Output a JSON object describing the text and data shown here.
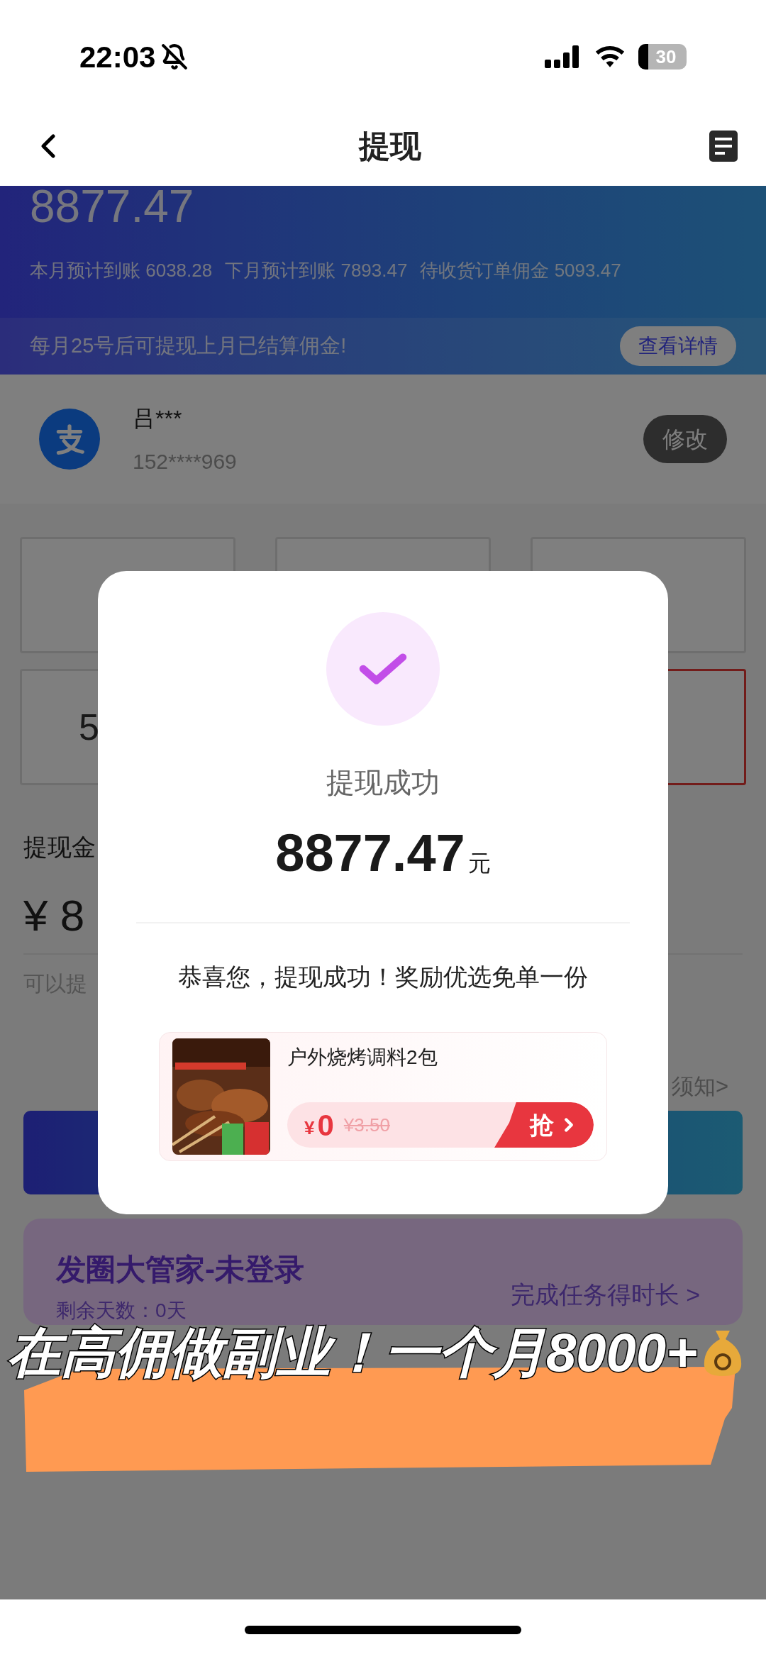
{
  "status_bar": {
    "time": "22:03",
    "battery": "30"
  },
  "nav": {
    "title": "提现"
  },
  "header": {
    "balance": "8877.47",
    "stats": [
      "本月预计到账 6038.28",
      "下月预计到账 7893.47",
      "待收货订单佣金 5093.47"
    ],
    "notice": "每月25号后可提现上月已结算佣金!",
    "details_button": "查看详情"
  },
  "account": {
    "name": "吕***",
    "phone": "152****969",
    "edit_button": "修改"
  },
  "tiles": [
    {
      "selected": false
    },
    {
      "selected": false
    },
    {
      "selected": false
    },
    {
      "label": "5",
      "selected": false
    },
    {
      "selected": true
    }
  ],
  "form": {
    "label": "提现金",
    "amount": "¥ 8",
    "hint": "可以提",
    "notice_link": "须知>"
  },
  "vip_card": {
    "title": "发圈大管家-未登录",
    "subtitle": "剩余天数：0天",
    "action": "完成任务得时长 >"
  },
  "dialog": {
    "title": "提现成功",
    "amount": "8877.47",
    "unit": "元",
    "message": "恭喜您，提现成功！奖励优选免单一份",
    "product": {
      "name": "户外烧烤调料2包",
      "currency": "¥",
      "price": "0",
      "original_price": "¥3.50",
      "grab_button": "抢"
    }
  },
  "caption": "在高佣做副业！一个月8000+"
}
